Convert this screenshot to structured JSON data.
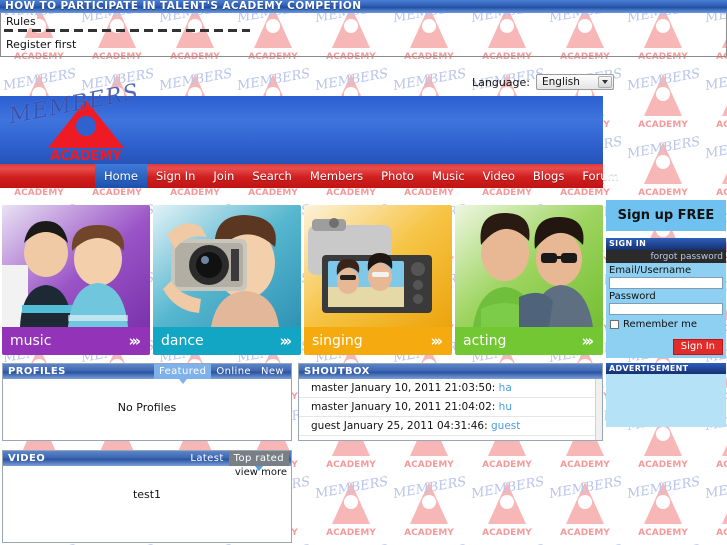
{
  "titlebar": {
    "text": "HOW TO PARTICIPATE IN TALENT'S ACADEMY COMPETION"
  },
  "rules_box": {
    "heading": "Rules",
    "note": "Register first"
  },
  "language": {
    "label": "Language:",
    "value": "English",
    "caret_icon": "chevron-down-icon"
  },
  "branding": {
    "logo_letter": "A",
    "logo_word": "ACADEMY",
    "watermark_word": "MEMBERS",
    "banner_color": "#2f62cf",
    "logo_color": "#ee1b24"
  },
  "nav": {
    "items": [
      {
        "label": "Home",
        "active": true
      },
      {
        "label": "Sign In",
        "active": false
      },
      {
        "label": "Join",
        "active": false
      },
      {
        "label": "Search",
        "active": false
      },
      {
        "label": "Members",
        "active": false
      },
      {
        "label": "Photo",
        "active": false
      },
      {
        "label": "Music",
        "active": false
      },
      {
        "label": "Video",
        "active": false
      },
      {
        "label": "Blogs",
        "active": false
      },
      {
        "label": "Forum",
        "active": false
      }
    ]
  },
  "tiles": [
    {
      "name": "music",
      "chevrons": "›››",
      "color": "#9333b8"
    },
    {
      "name": "dance",
      "chevrons": "›››",
      "color": "#13a6c4"
    },
    {
      "name": "singing",
      "chevrons": "›››",
      "color": "#f5ab10"
    },
    {
      "name": "acting",
      "chevrons": "›››",
      "color": "#72c732"
    }
  ],
  "sidebar": {
    "signup_label": "Sign up FREE",
    "signin_title": "SIGN IN",
    "forgot_password": "forgot password",
    "email_label": "Email/Username",
    "email_value": "",
    "password_label": "Password",
    "password_value": "",
    "remember_label": "Remember me",
    "signin_button": "Sign In",
    "ad_title": "ADVERTISEMENT"
  },
  "profiles_panel": {
    "title": "PROFILES",
    "tabs": [
      {
        "label": "Featured",
        "active": true
      },
      {
        "label": "Online",
        "active": false
      },
      {
        "label": "New",
        "active": false
      }
    ],
    "empty_text": "No Profiles"
  },
  "shoutbox_panel": {
    "title": "SHOUTBOX",
    "messages": [
      {
        "author": "master",
        "date": "January 10, 2011 21:03:50",
        "text": "ha"
      },
      {
        "author": "master",
        "date": "January 10, 2011 21:04:02",
        "text": "hu"
      },
      {
        "author": "guest",
        "date": "January 25, 2011 04:31:46",
        "text": "guest"
      }
    ]
  },
  "video_panel": {
    "title": "VIDEO",
    "tabs": [
      {
        "label": "Latest",
        "active": false
      },
      {
        "label": "Top rated",
        "active": true
      }
    ],
    "view_more": "view more",
    "item_title": "test1"
  }
}
